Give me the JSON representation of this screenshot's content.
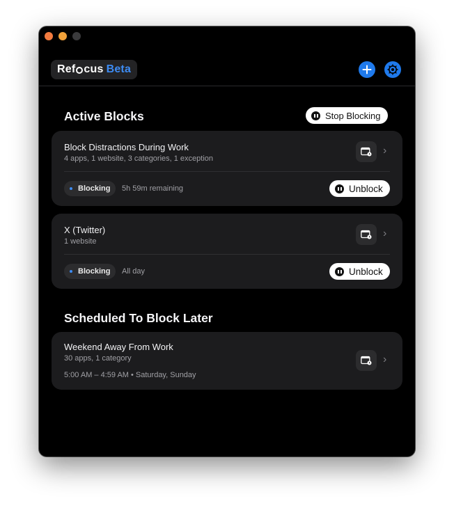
{
  "app": {
    "name_left": "Ref",
    "name_right": "cus",
    "badge": "Beta"
  },
  "active": {
    "title": "Active Blocks",
    "stop_label": "Stop Blocking",
    "blocks": [
      {
        "title": "Block Distractions During Work",
        "subtitle": "4 apps, 1 website, 3 categories, 1 exception",
        "status": "Blocking",
        "remaining": "5h 59m remaining",
        "unblock": "Unblock"
      },
      {
        "title": "X (Twitter)",
        "subtitle": "1 website",
        "status": "Blocking",
        "remaining": "All day",
        "unblock": "Unblock"
      }
    ]
  },
  "scheduled": {
    "title": "Scheduled To Block Later",
    "blocks": [
      {
        "title": "Weekend Away From Work",
        "subtitle": "30 apps, 1 category",
        "schedule": "5:00 AM – 4:59 AM • Saturday, Sunday"
      }
    ]
  },
  "icons": {
    "add": "plus-icon",
    "settings": "gear-icon",
    "calendar": "calendar-icon",
    "chevron": "chevron-right-icon",
    "pause": "pause-icon"
  },
  "colors": {
    "accent": "#1f7aec",
    "beta": "#3d8bf2",
    "card": "#1c1c1e",
    "background": "#000000",
    "traffic_red": "#f27b3f",
    "traffic_yellow": "#f0a13a"
  }
}
